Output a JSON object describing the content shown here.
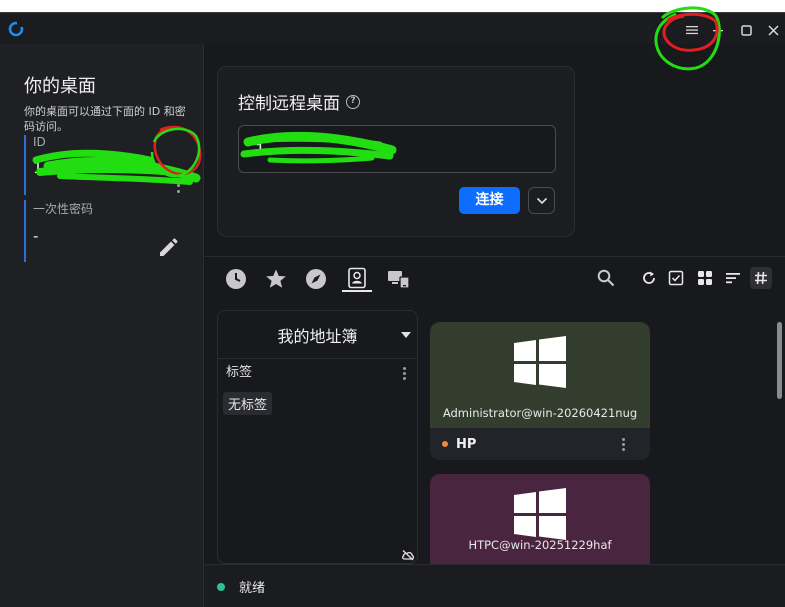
{
  "sidebar": {
    "title": "你的桌面",
    "description": "你的桌面可以通过下面的 ID 和密码访问。",
    "id_label": "ID",
    "id_value": "1 3",
    "password_label": "一次性密码",
    "password_value": "-"
  },
  "connect": {
    "title": "控制远程桌面",
    "input_value": "1",
    "connect_label": "连接"
  },
  "addressbook": {
    "name": "我的地址簿",
    "tags_label": "标签",
    "no_tag_label": "无标签"
  },
  "peers": [
    {
      "host": "Administrator@win-20260421nug",
      "alias": "HP",
      "bg": "#333d2e",
      "status_color": "#f08a3c"
    },
    {
      "host": "HTPC@win-20251229haf",
      "alias": "",
      "bg": "#4a2540",
      "status_color": "#f08a3c"
    }
  ],
  "status": {
    "text": "就绪",
    "color": "#2bbf9a"
  },
  "colors": {
    "accent": "#0d6efd",
    "background": "#18191c",
    "sidebar": "#1f2024"
  },
  "icons": [
    "rustdesk-logo",
    "menu-icon",
    "minimize-icon",
    "maximize-icon",
    "close-icon",
    "more-icon",
    "edit-icon",
    "help-icon",
    "chevron-down-icon",
    "clock-icon",
    "star-icon",
    "compass-icon",
    "address-book-icon",
    "lan-icon",
    "search-icon",
    "refresh-icon",
    "checkbox-icon",
    "grid-view-icon",
    "sort-icon",
    "hash-icon",
    "windows-logo-icon",
    "cloud-off-icon"
  ]
}
